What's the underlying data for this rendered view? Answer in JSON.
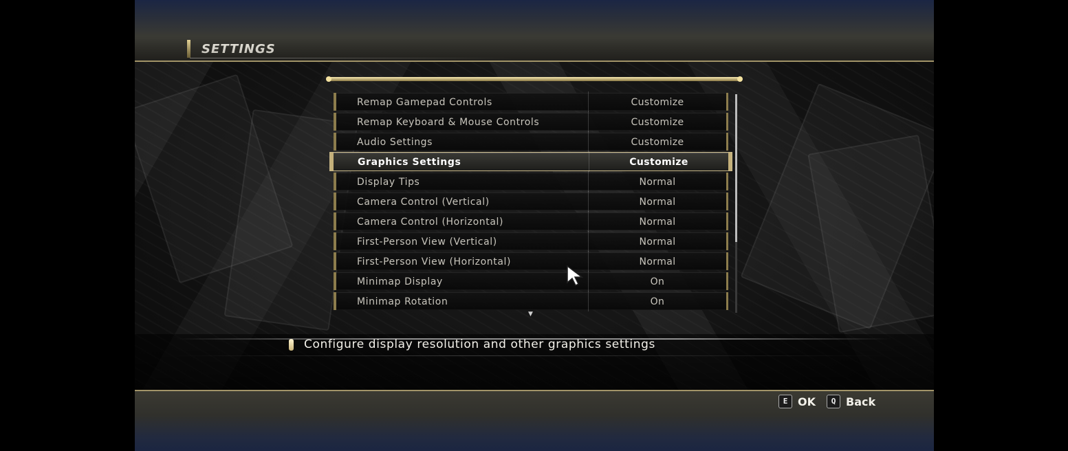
{
  "header": {
    "title": "SETTINGS"
  },
  "settings": [
    {
      "label": "Remap Gamepad Controls",
      "value": "Customize",
      "selected": false
    },
    {
      "label": "Remap Keyboard & Mouse Controls",
      "value": "Customize",
      "selected": false
    },
    {
      "label": "Audio Settings",
      "value": "Customize",
      "selected": false
    },
    {
      "label": "Graphics Settings",
      "value": "Customize",
      "selected": true
    },
    {
      "label": "Display Tips",
      "value": "Normal",
      "selected": false
    },
    {
      "label": "Camera Control (Vertical)",
      "value": "Normal",
      "selected": false
    },
    {
      "label": "Camera Control (Horizontal)",
      "value": "Normal",
      "selected": false
    },
    {
      "label": "First-Person View (Vertical)",
      "value": "Normal",
      "selected": false
    },
    {
      "label": "First-Person View (Horizontal)",
      "value": "Normal",
      "selected": false
    },
    {
      "label": "Minimap Display",
      "value": "On",
      "selected": false
    },
    {
      "label": "Minimap Rotation",
      "value": "On",
      "selected": false
    }
  ],
  "scroll": {
    "more_indicator": "▼"
  },
  "description": "Configure display resolution and other graphics settings",
  "hints": {
    "ok_key": "E",
    "ok_label": "OK",
    "back_key": "Q",
    "back_label": "Back"
  },
  "colors": {
    "accent_gold": "#c4b07a",
    "top_band": "#1b2644"
  }
}
